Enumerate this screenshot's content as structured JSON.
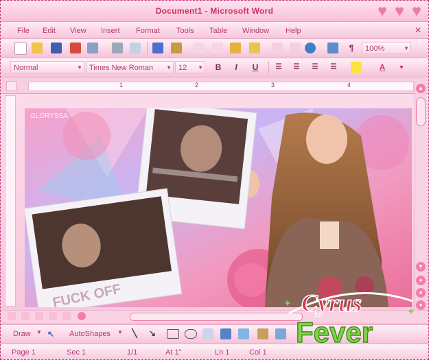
{
  "window": {
    "title": "Document1 - Microsoft Word",
    "accent": "#c8345f",
    "background": "#f7c3da"
  },
  "menu": [
    "File",
    "Edit",
    "View",
    "Insert",
    "Format",
    "Tools",
    "Table",
    "Window",
    "Help"
  ],
  "toolbar": {
    "zoom": "100%",
    "style": "Normal",
    "font": "Times New Roman",
    "size": "12",
    "bold": "B",
    "italic": "I",
    "underline": "U",
    "paragraph_mark": "¶"
  },
  "ruler": {
    "numbers": [
      "1",
      "2",
      "3",
      "4"
    ]
  },
  "document": {
    "watermark": "GLORYSSA",
    "overlay_text": "FUCK OFF"
  },
  "drawing": {
    "draw_label": "Draw",
    "autoshapes_label": "AutoShapes"
  },
  "status": {
    "page": "Page 1",
    "section": "Sec 1",
    "pages": "1/1",
    "at": "At 1\"",
    "line": "Ln 1",
    "column": "Col 1"
  },
  "stamp": {
    "line1": "Cyrus",
    "line2": "Fever"
  },
  "icons": [
    "new-icon",
    "open-icon",
    "save-icon",
    "permission-icon",
    "mail-icon",
    "print-icon",
    "preview-icon",
    "spelling-icon",
    "research-icon",
    "cut-icon",
    "copy-icon",
    "paste-icon",
    "format-painter-icon",
    "undo-icon",
    "redo-icon",
    "hyperlink-icon",
    "tables-icon",
    "paragraph-icon",
    "close-icon",
    "heart-icon"
  ]
}
